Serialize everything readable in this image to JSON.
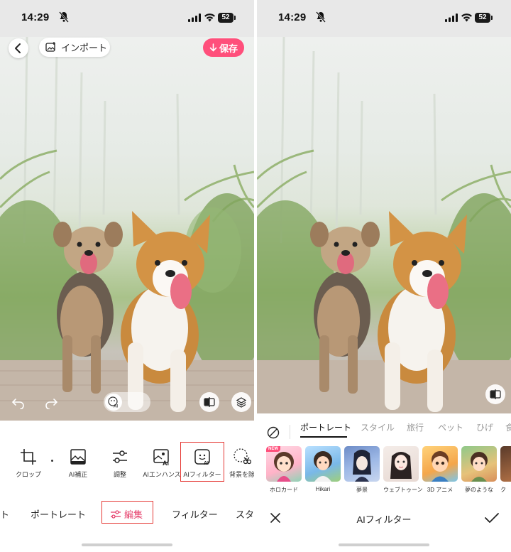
{
  "left_screen": {
    "status": {
      "time": "14:29",
      "battery": "52"
    },
    "header": {
      "import_label": "インポート",
      "save_label": "保存"
    },
    "tools": [
      {
        "label": "クロップ",
        "icon": "crop-icon"
      },
      {
        "label": "AI補正",
        "icon": "image-enhance-icon"
      },
      {
        "label": "調整",
        "icon": "sliders-icon"
      },
      {
        "label": "AIエンハンス",
        "icon": "ai-enhance-icon"
      },
      {
        "label": "AIフィルター",
        "icon": "ai-face-filter-icon",
        "highlighted": true
      },
      {
        "label": "背景を除",
        "icon": "scissors-icon"
      }
    ],
    "bottom_tabs": [
      {
        "label": "ト"
      },
      {
        "label": "ポートレート"
      },
      {
        "label": "編集",
        "active": true
      },
      {
        "label": "フィルター"
      },
      {
        "label": "スタ"
      }
    ],
    "highlight_color": "#e53935",
    "accent_color": "#ff4f7b"
  },
  "right_screen": {
    "status": {
      "time": "14:29",
      "battery": "52"
    },
    "categories": [
      {
        "label": "ポートレート",
        "active": true
      },
      {
        "label": "スタイル"
      },
      {
        "label": "旅行"
      },
      {
        "label": "ペット"
      },
      {
        "label": "ひげ"
      },
      {
        "label": "食"
      }
    ],
    "filters": [
      {
        "label": "ホロカード",
        "badge": "NEW"
      },
      {
        "label": "Hikari"
      },
      {
        "label": "夢景"
      },
      {
        "label": "ウェブトゥーン"
      },
      {
        "label": "3D アニメ"
      },
      {
        "label": "夢のような"
      },
      {
        "label": "ク"
      }
    ],
    "action_bar": {
      "title": "AIフィルター"
    }
  }
}
